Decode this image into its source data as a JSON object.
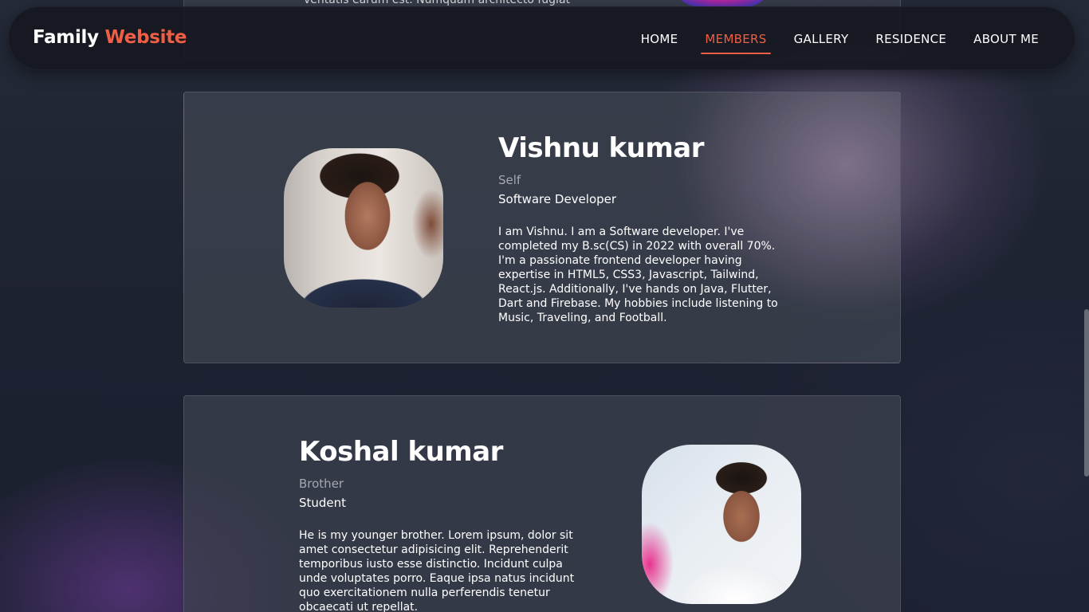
{
  "navbar": {
    "logo_part1": "Family",
    "logo_part2": "Website",
    "links": [
      {
        "label": "HOME",
        "active": false
      },
      {
        "label": "MEMBERS",
        "active": true
      },
      {
        "label": "GALLERY",
        "active": false
      },
      {
        "label": "RESIDENCE",
        "active": false
      },
      {
        "label": "ABOUT ME",
        "active": false
      }
    ]
  },
  "previous_card": {
    "text_line": "ventatis earum est. Numquam architecto fugiat"
  },
  "members": [
    {
      "name": "Vishnu kumar",
      "relation": "Self",
      "role": "Software Developer",
      "bio": "I am Vishnu. I am a Software developer. I've completed my B.sc(CS) in 2022 with overall 70%. I'm a passionate frontend developer having expertise in HTML5, CSS3, Javascript, Tailwind, React.js. Additionally, I've hands on Java, Flutter, Dart and Firebase. My hobbies include listening to Music, Traveling, and Football."
    },
    {
      "name": "Koshal kumar",
      "relation": "Brother",
      "role": "Student",
      "bio": "He is my younger brother. Lorem ipsum, dolor sit amet consectetur adipisicing elit. Reprehenderit temporibus iusto esse distinctio. Incidunt culpa unde voluptates porro. Eaque ipsa natus incidunt quo exercitationem nulla perferendis tenetur obcaecati ut repellat."
    }
  ],
  "colors": {
    "accent": "#ef5e45",
    "background": "#1c2130",
    "navbar": "#16181f"
  }
}
